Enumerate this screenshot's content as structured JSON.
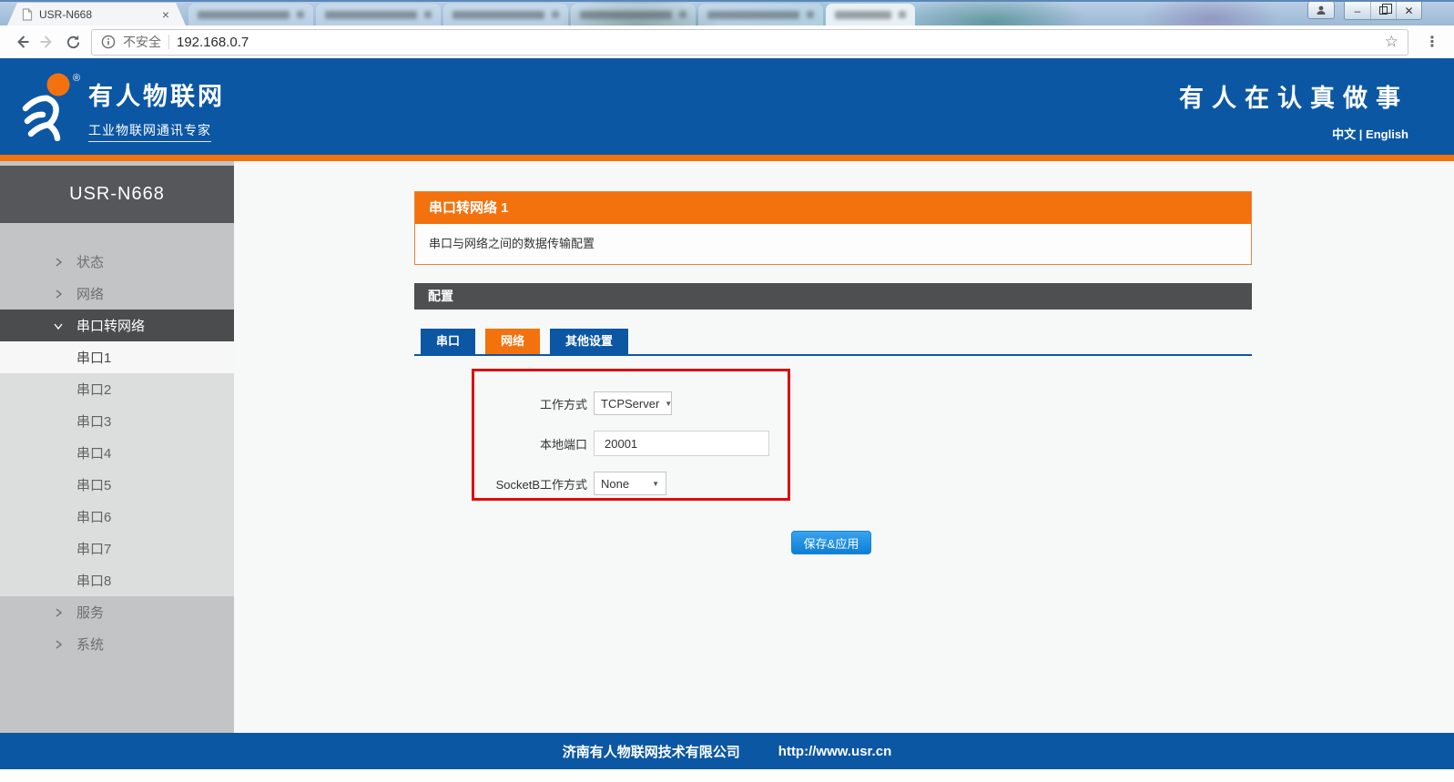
{
  "browser": {
    "active_tab_title": "USR-N668",
    "security_label": "不安全",
    "url": "192.168.0.7",
    "icons": {
      "close": "×",
      "minimize": "–",
      "star": "☆",
      "menu": "⋮"
    }
  },
  "header": {
    "brand_title": "有人物联网",
    "brand_subtitle": "工业物联网通讯专家",
    "slogan": "有人在认真做事",
    "lang_zh": "中文",
    "lang_divider": " | ",
    "lang_en": "English"
  },
  "sidebar": {
    "device_model": "USR-N668",
    "items": [
      {
        "label": "状态"
      },
      {
        "label": "网络"
      },
      {
        "label": "串口转网络"
      },
      {
        "label": "串口1"
      },
      {
        "label": "串口2"
      },
      {
        "label": "串口3"
      },
      {
        "label": "串口4"
      },
      {
        "label": "串口5"
      },
      {
        "label": "串口6"
      },
      {
        "label": "串口7"
      },
      {
        "label": "串口8"
      },
      {
        "label": "服务"
      },
      {
        "label": "系统"
      }
    ]
  },
  "main": {
    "section_title": "串口转网络 1",
    "section_desc": "串口与网络之间的数据传输配置",
    "config_title": "配置",
    "tabs": [
      {
        "label": "串口"
      },
      {
        "label": "网络"
      },
      {
        "label": "其他设置"
      }
    ],
    "form": {
      "rows": [
        {
          "label": "工作方式",
          "value": "TCPServer",
          "type": "select"
        },
        {
          "label": "本地端口",
          "value": "20001",
          "type": "input"
        },
        {
          "label": "SocketB工作方式",
          "value": "None",
          "type": "select"
        }
      ],
      "dropdown_caret": "▼"
    },
    "save_button": "保存&应用"
  },
  "footer": {
    "company": "济南有人物联网技术有限公司",
    "url": "http://www.usr.cn"
  },
  "colors": {
    "brand_blue": "#0b57a4",
    "brand_orange": "#f3720d",
    "annotation_red": "#dd0b0b",
    "bar_gray": "#4e4f51"
  }
}
